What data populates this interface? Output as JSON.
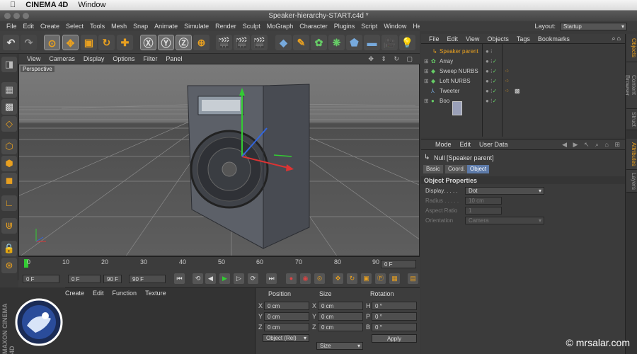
{
  "os_menu": {
    "app": "CINEMA 4D",
    "window": "Window"
  },
  "window_title": "Speaker-hierarchy-START.c4d *",
  "menu": [
    "File",
    "Edit",
    "Create",
    "Select",
    "Tools",
    "Mesh",
    "Snap",
    "Animate",
    "Simulate",
    "Render",
    "Sculpt",
    "MoGraph",
    "Character",
    "Plugins",
    "Script",
    "Window",
    "Help"
  ],
  "layout": {
    "label": "Layout:",
    "value": "Startup"
  },
  "viewport": {
    "menu": [
      "View",
      "Cameras",
      "Display",
      "Options",
      "Filter",
      "Panel"
    ],
    "label": "Perspective"
  },
  "timeline": {
    "ticks": [
      "0",
      "10",
      "20",
      "30",
      "40",
      "50",
      "60",
      "70",
      "80",
      "90"
    ],
    "end_frame": "0 F"
  },
  "playback": {
    "start": "0 F",
    "min": "0 F",
    "max": "90 F",
    "end": "90 F"
  },
  "material_menu": [
    "Create",
    "Edit",
    "Function",
    "Texture"
  ],
  "coords": {
    "headers": [
      "Position",
      "Size",
      "Rotation"
    ],
    "rows": [
      {
        "a": "X",
        "av": "0 cm",
        "b": "X",
        "bv": "0 cm",
        "c": "H",
        "cv": "0 °"
      },
      {
        "a": "Y",
        "av": "0 cm",
        "b": "Y",
        "bv": "0 cm",
        "c": "P",
        "cv": "0 °"
      },
      {
        "a": "Z",
        "av": "0 cm",
        "b": "Z",
        "bv": "0 cm",
        "c": "B",
        "cv": "0 °"
      }
    ],
    "mode": "Object (Rel)",
    "size_mode": "Size",
    "apply": "Apply"
  },
  "objects": {
    "menu": [
      "File",
      "Edit",
      "View",
      "Objects",
      "Tags",
      "Bookmarks"
    ],
    "items": [
      {
        "name": "Speaker parent",
        "color": "#e8a020"
      },
      {
        "name": "Array",
        "color": "#9cd"
      },
      {
        "name": "Sweep NURBS",
        "color": "#9cd"
      },
      {
        "name": "Loft NURBS",
        "color": "#9cd"
      },
      {
        "name": "Tweeter",
        "color": "#9cd"
      },
      {
        "name": "Boo",
        "color": "#9cd"
      }
    ]
  },
  "attributes": {
    "menu": [
      "Mode",
      "Edit",
      "User Data"
    ],
    "object_title": "Null [Speaker parent]",
    "tabs": [
      "Basic",
      "Coord.",
      "Object"
    ],
    "section": "Object Properties",
    "props": [
      {
        "label": "Display. . . . .",
        "value": "Dot"
      },
      {
        "label": "Radius . . . . .",
        "value": "10 cm"
      },
      {
        "label": "Aspect Ratio",
        "value": "1"
      },
      {
        "label": "Orientation",
        "value": "Camera"
      }
    ]
  },
  "side_tabs": [
    "Objects",
    "Content Browser",
    "Struct",
    "Attributes",
    "Layers"
  ],
  "branding": {
    "line1": "MAXON",
    "line2": "CINEMA 4D"
  },
  "watermark": "© mrsalar.com"
}
